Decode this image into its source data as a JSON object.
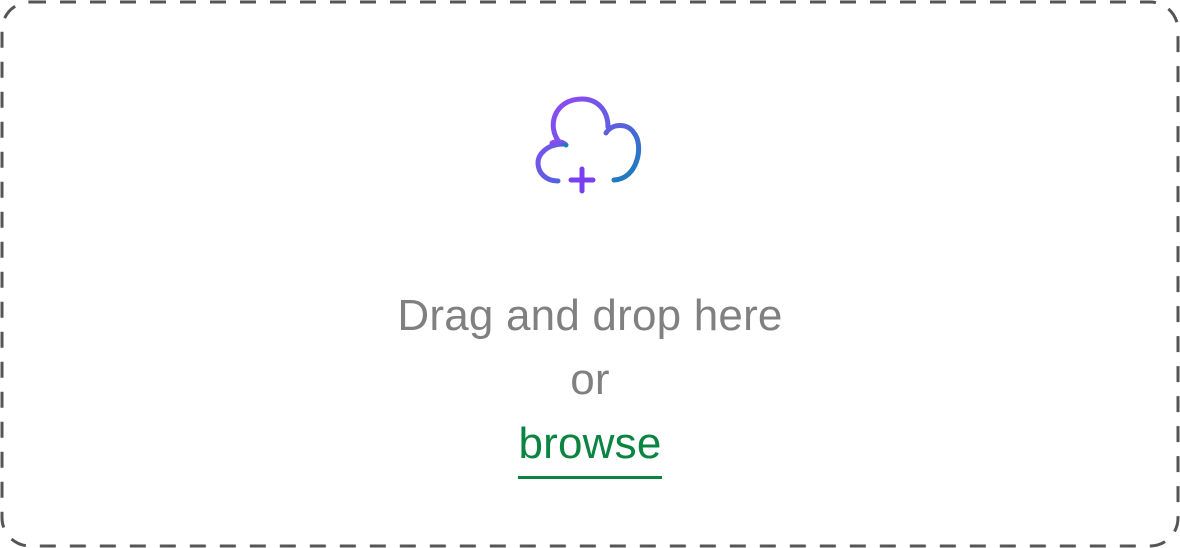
{
  "dropzone": {
    "prompt": "Drag and drop here",
    "separator": "or",
    "browse_label": "browse",
    "icon": "cloud-upload-plus-icon"
  },
  "colors": {
    "border": "#555555",
    "prompt_text": "#808080",
    "browse_link": "#0a8441",
    "icon_gradient_start": "#8b3cf7",
    "icon_gradient_end": "#1a7ec0"
  }
}
